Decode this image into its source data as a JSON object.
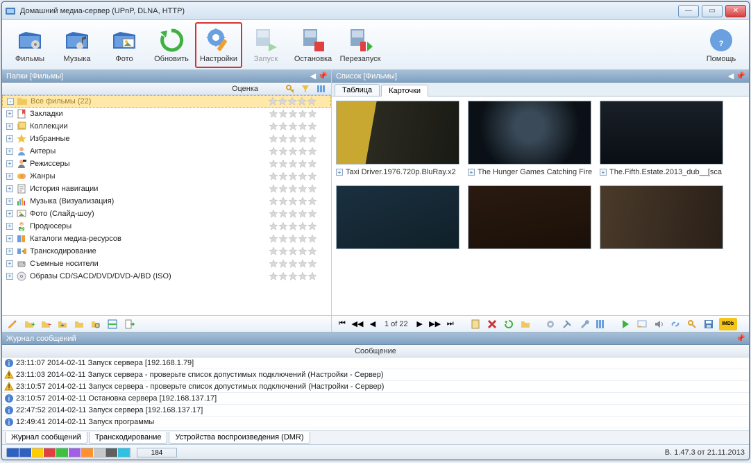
{
  "window": {
    "title": "Домашний медиа-сервер (UPnP, DLNA, HTTP)"
  },
  "toolbar": {
    "films": "Фильмы",
    "music": "Музыка",
    "photo": "Фото",
    "refresh": "Обновить",
    "settings": "Настройки",
    "start": "Запуск",
    "stop": "Остановка",
    "restart": "Перезапуск",
    "help": "Помощь"
  },
  "left": {
    "header": "Папки [Фильмы]",
    "col_rating": "Оценка",
    "items": [
      {
        "label": "Все фильмы (22)",
        "icon": "folder",
        "selected": true,
        "expand": "-",
        "color": "#c0a040"
      },
      {
        "label": "Закладки",
        "icon": "bookmark",
        "expand": "+"
      },
      {
        "label": "Коллекции",
        "icon": "collections",
        "expand": "+"
      },
      {
        "label": "Избранные",
        "icon": "star",
        "expand": "+"
      },
      {
        "label": "Актеры",
        "icon": "person",
        "expand": "+"
      },
      {
        "label": "Режиссеры",
        "icon": "director",
        "expand": "+"
      },
      {
        "label": "Жанры",
        "icon": "genres",
        "expand": "+"
      },
      {
        "label": "История навигации",
        "icon": "history",
        "expand": "+"
      },
      {
        "label": "Музыка (Визуализация)",
        "icon": "music-vis",
        "expand": "+"
      },
      {
        "label": "Фото (Слайд-шоу)",
        "icon": "photo-slide",
        "expand": "+"
      },
      {
        "label": "Продюсеры",
        "icon": "producers",
        "expand": "+"
      },
      {
        "label": "Каталоги медиа-ресурсов",
        "icon": "catalog",
        "expand": "+"
      },
      {
        "label": "Транскодирование",
        "icon": "transcode",
        "expand": "+"
      },
      {
        "label": "Съемные носители",
        "icon": "removable",
        "expand": "+"
      },
      {
        "label": "Образы CD/SACD/DVD/DVD-A/BD (ISO)",
        "icon": "disc",
        "expand": "+"
      }
    ]
  },
  "right": {
    "header": "Список [Фильмы]",
    "tabs": {
      "table": "Таблица",
      "cards": "Карточки"
    },
    "cards": [
      {
        "title": "Taxi Driver.1976.720p.BluRay.x2"
      },
      {
        "title": "The Hunger Games Catching Fire."
      },
      {
        "title": "The.Fifth.Estate.2013_dub__[sca"
      },
      {
        "title": ""
      },
      {
        "title": ""
      },
      {
        "title": ""
      }
    ],
    "pager": "1 of 22"
  },
  "log": {
    "header": "Журнал сообщений",
    "col": "Сообщение",
    "rows": [
      {
        "icon": "info",
        "text": "23:11:07 2014-02-11 Запуск сервера [192.168.1.79]"
      },
      {
        "icon": "warn",
        "text": "23:11:03 2014-02-11 Запуск сервера - проверьте список допустимых подключений (Настройки - Сервер)"
      },
      {
        "icon": "warn",
        "text": "23:10:57 2014-02-11 Запуск сервера - проверьте список допустимых подключений (Настройки - Сервер)"
      },
      {
        "icon": "info",
        "text": "23:10:57 2014-02-11 Остановка сервера [192.168.137.17]"
      },
      {
        "icon": "info",
        "text": "22:47:52 2014-02-11 Запуск сервера [192.168.137.17]"
      },
      {
        "icon": "info",
        "text": "12:49:41 2014-02-11 Запуск программы"
      }
    ],
    "tabs": {
      "log": "Журнал сообщений",
      "trans": "Транскодирование",
      "dmr": "Устройства воспроизведения (DMR)"
    }
  },
  "status": {
    "count": "184",
    "version": "В. 1.47.3 от 21.11.2013",
    "seg_colors": [
      "#3060c0",
      "#3060c0",
      "#ffcc00",
      "#e04040",
      "#40c040",
      "#a060e0",
      "#ff9030",
      "#c8c8c8",
      "#606060",
      "#30c0e0"
    ]
  }
}
